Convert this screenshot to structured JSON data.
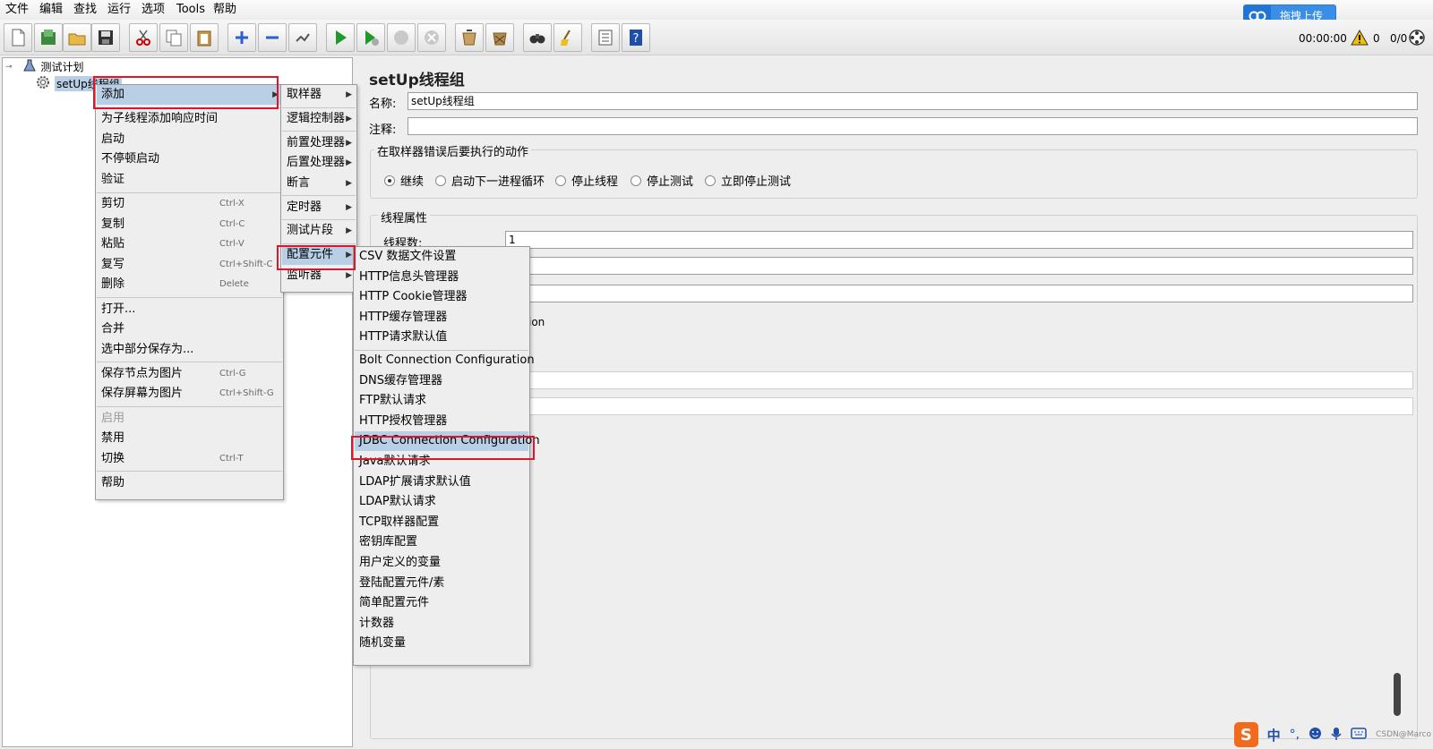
{
  "menubar": [
    "文件",
    "编辑",
    "查找",
    "运行",
    "选项",
    "Tools",
    "帮助"
  ],
  "upload": {
    "label": "拖拽上传"
  },
  "status": {
    "timer": "00:00:00",
    "errors": "0",
    "ratio": "0/0"
  },
  "tree": {
    "root": "测试计划",
    "child": "setUp线程组"
  },
  "panel": {
    "title": "setUp线程组",
    "name_label": "名称:",
    "name_value": "setUp线程组",
    "comment_label": "注释:",
    "comment_value": "",
    "error_group_title": "在取样器错误后要执行的动作",
    "radios": [
      {
        "label": "继续",
        "checked": true
      },
      {
        "label": "启动下一进程循环",
        "checked": false
      },
      {
        "label": "停止线程",
        "checked": false
      },
      {
        "label": "停止测试",
        "checked": false
      },
      {
        "label": "立即停止测试",
        "checked": false
      }
    ],
    "thread_group_title": "线程属性",
    "threads_label": "线程数:",
    "threads_value": "1",
    "partial_text": "ion"
  },
  "context_menu": [
    {
      "label": "添加",
      "shortcut": "",
      "submenu": true,
      "highlight": true
    },
    {
      "separator": true
    },
    {
      "label": "为子线程添加响应时间",
      "shortcut": ""
    },
    {
      "label": "启动",
      "shortcut": ""
    },
    {
      "label": "不停顿启动",
      "shortcut": ""
    },
    {
      "label": "验证",
      "shortcut": ""
    },
    {
      "separator": true
    },
    {
      "label": "剪切",
      "shortcut": "Ctrl-X"
    },
    {
      "label": "复制",
      "shortcut": "Ctrl-C"
    },
    {
      "label": "粘贴",
      "shortcut": "Ctrl-V"
    },
    {
      "label": "复写",
      "shortcut": "Ctrl+Shift-C"
    },
    {
      "label": "删除",
      "shortcut": "Delete"
    },
    {
      "separator": true
    },
    {
      "label": "打开...",
      "shortcut": ""
    },
    {
      "label": "合并",
      "shortcut": ""
    },
    {
      "label": "选中部分保存为...",
      "shortcut": ""
    },
    {
      "separator": true
    },
    {
      "label": "保存节点为图片",
      "shortcut": "Ctrl-G"
    },
    {
      "label": "保存屏幕为图片",
      "shortcut": "Ctrl+Shift-G"
    },
    {
      "separator": true
    },
    {
      "label": "启用",
      "shortcut": "",
      "disabled": true
    },
    {
      "label": "禁用",
      "shortcut": ""
    },
    {
      "label": "切换",
      "shortcut": "Ctrl-T"
    },
    {
      "separator": true
    },
    {
      "label": "帮助",
      "shortcut": ""
    }
  ],
  "add_submenu": [
    {
      "label": "取样器",
      "submenu": true
    },
    {
      "separator": true
    },
    {
      "label": "逻辑控制器",
      "submenu": true
    },
    {
      "separator": true
    },
    {
      "label": "前置处理器",
      "submenu": true
    },
    {
      "label": "后置处理器",
      "submenu": true
    },
    {
      "label": "断言",
      "submenu": true
    },
    {
      "separator": true
    },
    {
      "label": "定时器",
      "submenu": true
    },
    {
      "separator": true
    },
    {
      "label": "测试片段",
      "submenu": true
    },
    {
      "separator": true
    },
    {
      "label": "配置元件",
      "submenu": true,
      "highlight": true
    },
    {
      "label": "监听器",
      "submenu": true
    }
  ],
  "config_submenu": [
    {
      "label": "CSV 数据文件设置"
    },
    {
      "label": "HTTP信息头管理器"
    },
    {
      "label": "HTTP Cookie管理器"
    },
    {
      "label": "HTTP缓存管理器"
    },
    {
      "label": "HTTP请求默认值"
    },
    {
      "separator": true
    },
    {
      "label": "Bolt Connection Configuration"
    },
    {
      "label": "DNS缓存管理器"
    },
    {
      "label": "FTP默认请求"
    },
    {
      "label": "HTTP授权管理器"
    },
    {
      "label": "JDBC Connection Configuration",
      "highlight": true
    },
    {
      "label": "Java默认请求"
    },
    {
      "label": "LDAP扩展请求默认值"
    },
    {
      "label": "LDAP默认请求"
    },
    {
      "label": "TCP取样器配置"
    },
    {
      "label": "密钥库配置"
    },
    {
      "label": "用户定义的变量"
    },
    {
      "label": "登陆配置元件/素"
    },
    {
      "label": "简单配置元件"
    },
    {
      "label": "计数器"
    },
    {
      "label": "随机变量"
    }
  ],
  "ime": {
    "logo": "S",
    "lang": "中",
    "punct": "°,"
  },
  "watermark": "CSDN@Marco"
}
